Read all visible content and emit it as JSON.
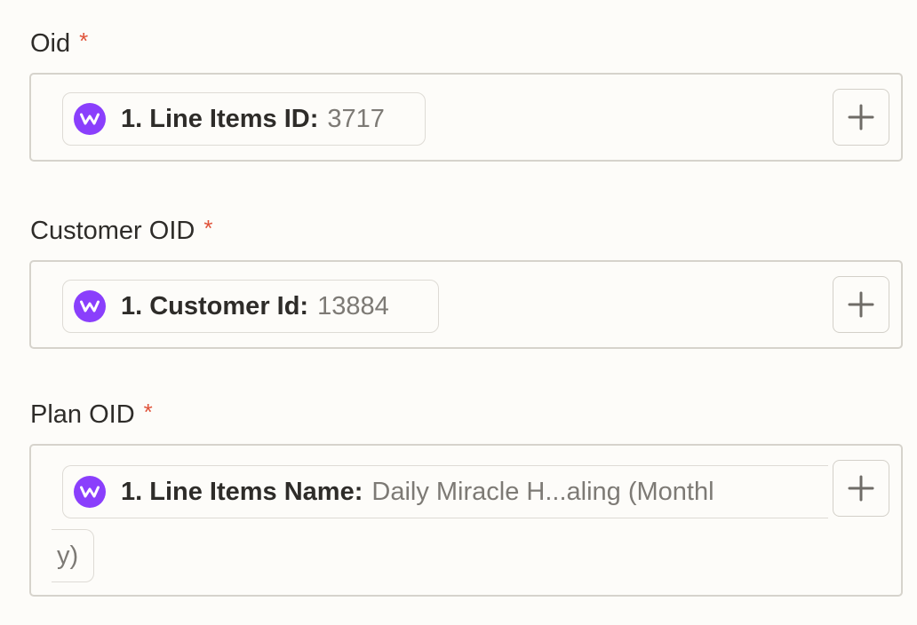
{
  "fields": [
    {
      "label": "Oid",
      "required_mark": "*",
      "pill": {
        "icon": "webhook-app-icon",
        "key": "1. Line Items ID:",
        "value": "3717"
      },
      "add_button_icon": "plus-icon"
    },
    {
      "label": "Customer OID",
      "required_mark": "*",
      "pill": {
        "icon": "webhook-app-icon",
        "key": "1. Customer Id:",
        "value": "13884"
      },
      "add_button_icon": "plus-icon"
    },
    {
      "label": "Plan OID",
      "required_mark": "*",
      "pill": {
        "icon": "webhook-app-icon",
        "key": "1. Line Items Name:",
        "value": "Daily Miracle H...aling (Monthl",
        "value_wrapped": "y)"
      },
      "add_button_icon": "plus-icon"
    }
  ],
  "colors": {
    "background": "#fdfcf9",
    "required": "#e0533a",
    "app_icon": "#8a3ffc",
    "border": "#d6d3cc",
    "value_text": "#7d7a75"
  }
}
